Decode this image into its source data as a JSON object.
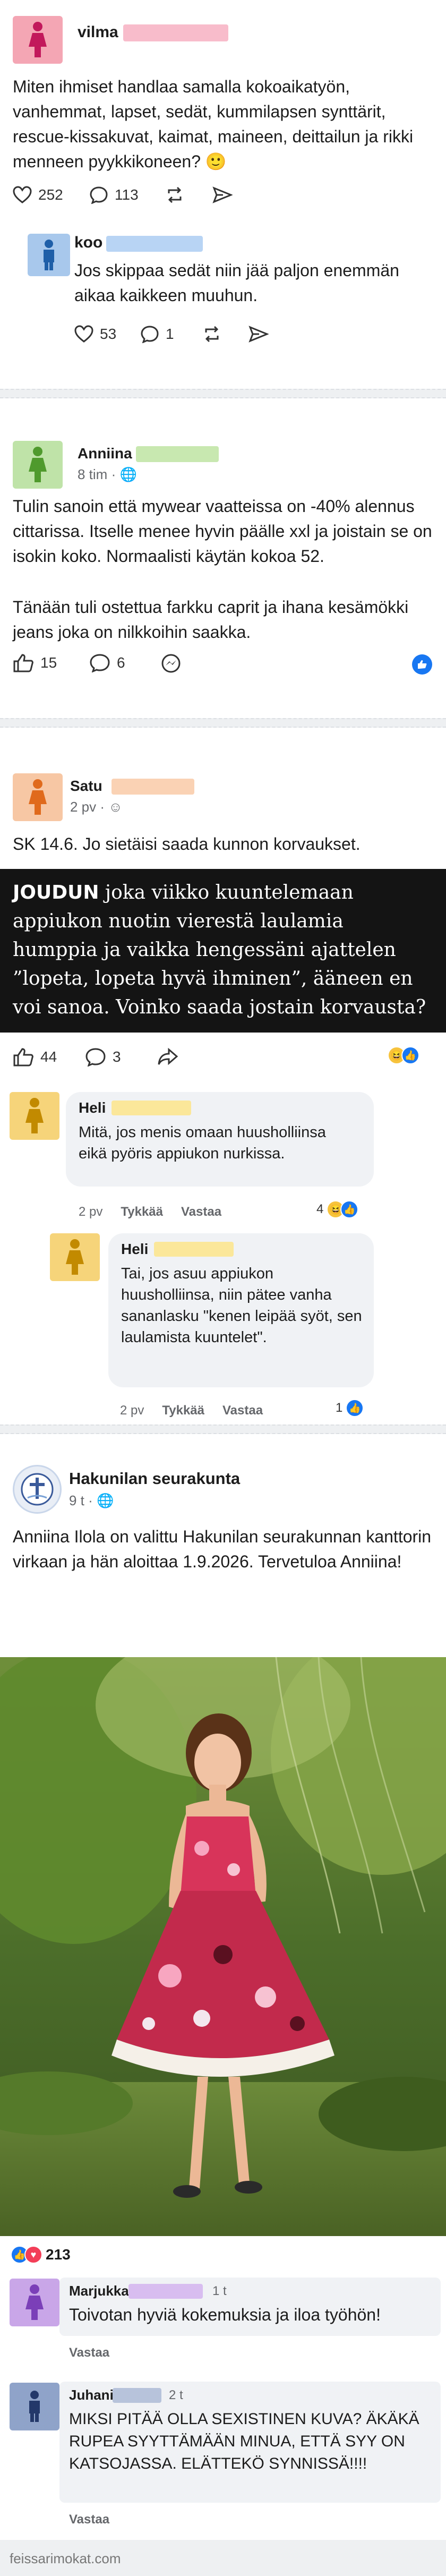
{
  "post1": {
    "author": "vilma",
    "text": "Miten ihmiset handlaa samalla kokoaikatyön, vanhemmat, lapset, sedät, kummilapsen synttärit, rescue-kissakuvat, kaimat, maineen, deittailun ja rikki menneen pyykkikoneen? 🙂",
    "likes": "252",
    "comments": "113",
    "reply": {
      "author": "koo",
      "text": "Jos skippaa sedät niin jää paljon enemmän aikaa kaikkeen muuhun.",
      "likes": "53",
      "comments": "1"
    }
  },
  "post2": {
    "author": "Anniina",
    "time": "8 tim · 🌐",
    "text1": "Tulin sanoin että mywear vaatteissa on -40% alennus cittarissa. Itselle menee hyvin päälle xxl ja joistain se on isokin koko. Normaalisti käytän kokoa 52.",
    "text2": "Tänään tuli ostettua farkku caprit ja ihana kesämökki jeans joka on nilkkoihin saakka.",
    "likes": "15",
    "comments": "6"
  },
  "post3": {
    "author": "Satu",
    "time": "2 pv · ☺",
    "text": "SK 14.6. Jo sietäisi saada kunnon korvaukset.",
    "banner_bold": "JOUDUN",
    "banner_text": " joka viikko kuuntelemaan appiukon nuotin vierestä laulamia humppia ja vaikka hengessäni ajattelen ”lopeta, lopeta hyvä ihminen”, ääneen en voi sanoa. Voinko saada jostain korvausta?",
    "likes": "44",
    "comments": "3",
    "comment1": {
      "author": "Heli",
      "text": "Mitä, jos menis omaan huusholliinsa eikä pyöris appiukon nurkissa.",
      "time": "2 pv",
      "like_label": "Tykkää",
      "reply_label": "Vastaa",
      "reacts": "4"
    },
    "comment2": {
      "author": "Heli",
      "text": "Tai, jos asuu appiukon huusholliinsa, niin pätee vanha sananlasku \"kenen leipää syöt, sen laulamista kuuntelet\".",
      "time": "2 pv",
      "like_label": "Tykkää",
      "reply_label": "Vastaa",
      "reacts": "1"
    }
  },
  "post4": {
    "author": "Hakunilan seurakunta",
    "time": "9 t · 🌐",
    "text": "Anniina Ilola on valittu Hakunilan seurakunnan kanttorin virkaan ja hän aloittaa 1.9.2026. Tervetuloa Anniina!",
    "reactions": "213",
    "comment1": {
      "author": "Marjukka",
      "time": "1 t",
      "text": "Toivotan hyviä kokemuksia ja iloa työhön!",
      "reply_label": "Vastaa"
    },
    "comment2": {
      "author": "Juhani",
      "time": "2 t",
      "text": "MIKSI PITÄÄ OLLA SEXISTINEN KUVA? ÄKÄKÄ RUPEA SYYTTÄMÄÄN MINUA, ETTÄ SYY ON KATSOJASSA. ELÄTTEKÖ SYNNISSÄ!!!!",
      "reply_label": "Vastaa"
    }
  },
  "footer": {
    "watermark": "feissarimokat.com"
  },
  "colors": {
    "pink_avatar": "#f4a6b4",
    "blue_avatar": "#a8c8ec",
    "green_avatar": "#bfe3a8",
    "orange_avatar": "#f7c7a4",
    "yellow_avatar": "#f6d47a",
    "purple_avatar": "#c9a6e8",
    "navy_avatar": "#8fa3c9",
    "fb_blue": "#1877f2",
    "dark_banner": "#141414"
  }
}
